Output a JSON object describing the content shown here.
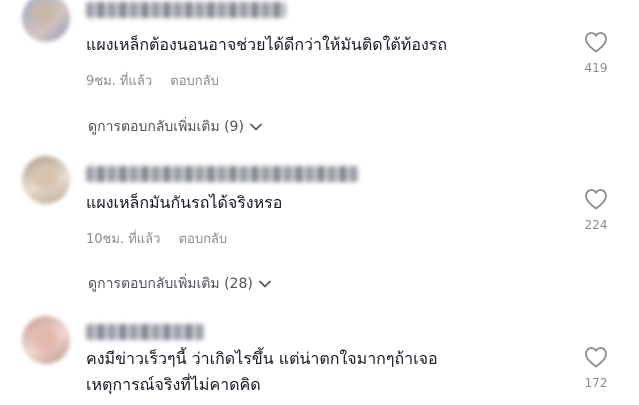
{
  "comments": [
    {
      "text": "แผงเหล็กต้องนอนอาจช่วยได้ดีกว่าให้มันติดใต้ท้องรถ",
      "time": "9ชม. ที่แล้ว",
      "reply_label": "ตอบกลับ",
      "likes": "419",
      "view_replies": "ดูการตอบกลับเพิ่มเติม (9)"
    },
    {
      "text": "แผงเหล็กมันกันรถได้จริงหรอ",
      "time": "10ชม. ที่แล้ว",
      "reply_label": "ตอบกลับ",
      "likes": "224",
      "view_replies": "ดูการตอบกลับเพิ่มเติม (28)"
    },
    {
      "text_line1": "คงมีข่าวเร็วๆนี้ ว่าเกิดไรขึ้น แต่น่าตกใจมากๆถ้าเจอ",
      "text_line2": "เหตุการณ์จริงที่ไม่คาดคิด",
      "likes": "172"
    }
  ],
  "colors": {
    "text": "#161823",
    "muted": "#8a8b91",
    "background": "#ffffff"
  },
  "icons": {
    "like": "heart-outline-icon",
    "expand": "chevron-down-icon"
  }
}
